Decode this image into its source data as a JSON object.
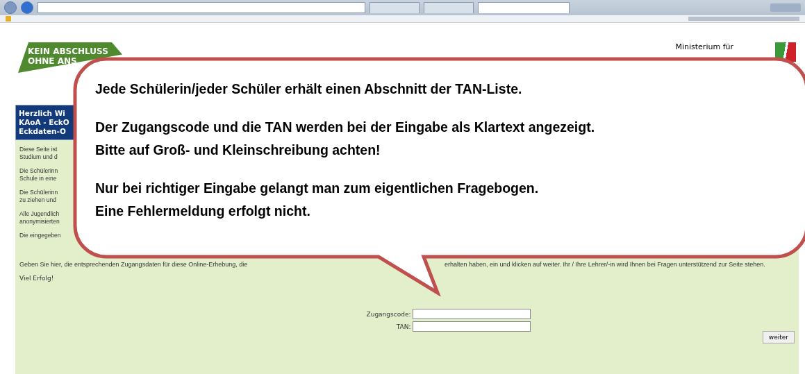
{
  "browser": {
    "tabs": [
      {
        "selected": false
      },
      {
        "selected": false
      },
      {
        "selected": true
      }
    ]
  },
  "page": {
    "logo": {
      "lines": [
        "KEIN ABSCHLUSS",
        "OHNE ANS"
      ]
    },
    "ministry": "Ministerium für",
    "header_lines": [
      "Herzlich Wi",
      "KAoA - EckO",
      "Eckdaten-O"
    ],
    "intro_fragments": [
      [
        "Diese Seite ist",
        "Studium und d"
      ],
      [
        "Die Schülerinn",
        "Schule in eine"
      ],
      [
        "Die Schülerinn",
        "zu ziehen und"
      ],
      [
        "Alle Jugendlich",
        "anonymisierten"
      ],
      [
        "Die eingegeben"
      ]
    ],
    "instruction": [
      "Geben Sie hier, die entsprechenden Zugangsdaten für diese Online-Erhebung, die",
      "erhalten haben, ein und klicken auf weiter. Ihr / Ihre Lehrer/-in wird Ihnen bei Fragen unterstützend zur Seite stehen."
    ],
    "greeting": "Viel Erfolg!",
    "fields": [
      {
        "label": "Zugangscode:"
      },
      {
        "label": "TAN:"
      }
    ],
    "submit": "weiter"
  },
  "callout": {
    "paragraphs": [
      [
        "Jede Schülerin/jeder Schüler erhält einen Abschnitt der TAN-Liste."
      ],
      [
        "Der Zugangscode und die TAN werden bei der Eingabe als Klartext angezeigt.",
        "Bitte auf Groß- und Kleinschreibung achten!"
      ],
      [
        "Nur bei richtiger Eingabe gelangt man zum eigentlichen Fragebogen.",
        "Eine Fehlermeldung erfolgt nicht."
      ]
    ]
  }
}
